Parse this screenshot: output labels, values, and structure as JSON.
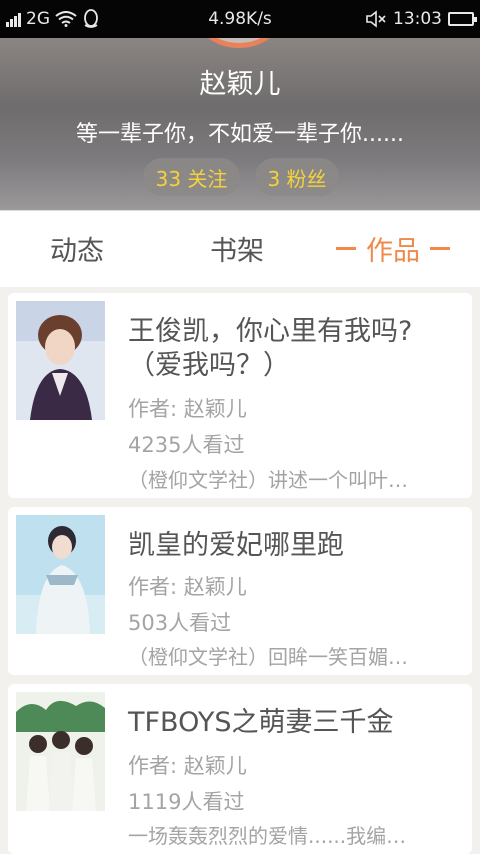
{
  "status_bar": {
    "network": "2G",
    "speed": "4.98K/s",
    "time": "13:03"
  },
  "profile": {
    "name": "赵颖儿",
    "motto": "等一辈子你，不如爱一辈子你......",
    "following": "33 关注",
    "fans": "3 粉丝"
  },
  "tabs": {
    "dynamic": "动态",
    "bookshelf": "书架",
    "works": "作品"
  },
  "works": [
    {
      "title": "王俊凯，你心里有我吗?（爱我吗？）",
      "author": "作者: 赵颖儿",
      "views": "4235人看过",
      "description": "（橙仰文学社）讲述一个叫叶…"
    },
    {
      "title": "凯皇的爱妃哪里跑",
      "author": "作者: 赵颖儿",
      "views": "503人看过",
      "description": "（橙仰文学社）回眸一笑百媚…"
    },
    {
      "title": "TFBOYS之萌妻三千金",
      "author": "作者: 赵颖儿",
      "views": "1119人看过",
      "description": "一场轰轰烈烈的爱情......我编…"
    }
  ],
  "colors": {
    "accent": "#f08a4b",
    "pill_text": "#f5d23c",
    "battery": "#2ecc40"
  }
}
